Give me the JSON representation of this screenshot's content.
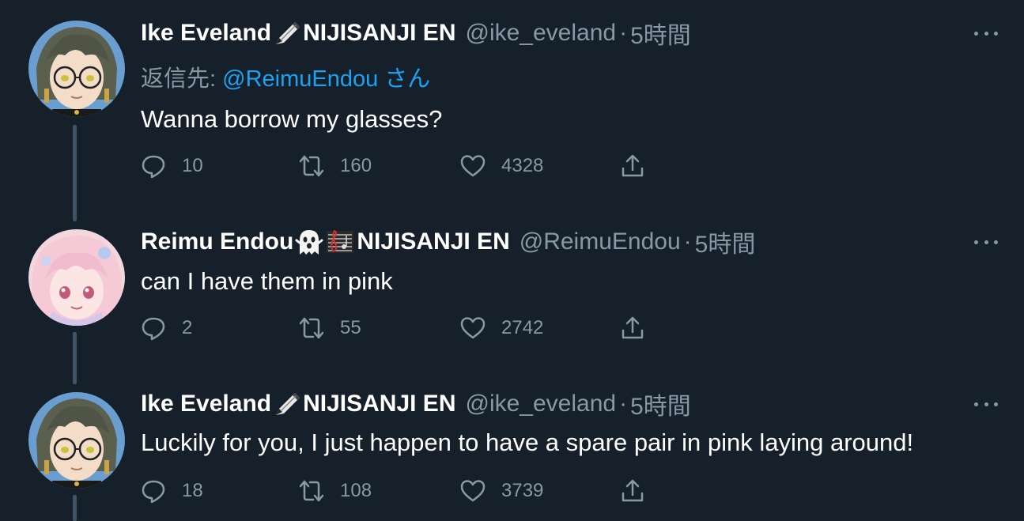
{
  "tweets": [
    {
      "name": "Ike Eveland",
      "suffix": "NIJISANJI EN",
      "handle": "@ike_eveland",
      "separator": "·",
      "time": "5時間",
      "reply_label": "返信先: ",
      "reply_mention": "@ReimuEndou",
      "reply_suffix": " さん",
      "text": "Wanna borrow my glasses?",
      "replies": "10",
      "retweets": "160",
      "likes": "4328",
      "emoji": [
        "pen-icon"
      ]
    },
    {
      "name": "Reimu Endou",
      "suffix": "NIJISANJI EN",
      "handle": "@ReimuEndou",
      "separator": "·",
      "time": "5時間",
      "text": "can I have them in pink",
      "replies": "2",
      "retweets": "55",
      "likes": "2742",
      "emoji": [
        "ghost-icon",
        "music-score-icon"
      ]
    },
    {
      "name": "Ike Eveland",
      "suffix": "NIJISANJI EN",
      "handle": "@ike_eveland",
      "separator": "·",
      "time": "5時間",
      "text": "Luckily for you, I just happen to have a spare pair in pink laying around!",
      "replies": "18",
      "retweets": "108",
      "likes": "3739",
      "emoji": [
        "pen-icon"
      ]
    }
  ],
  "colors": {
    "background": "#15202b",
    "text": "#ffffff",
    "secondary": "#8899a6",
    "mention": "#1da1f2",
    "thread_line": "#3d5466"
  }
}
